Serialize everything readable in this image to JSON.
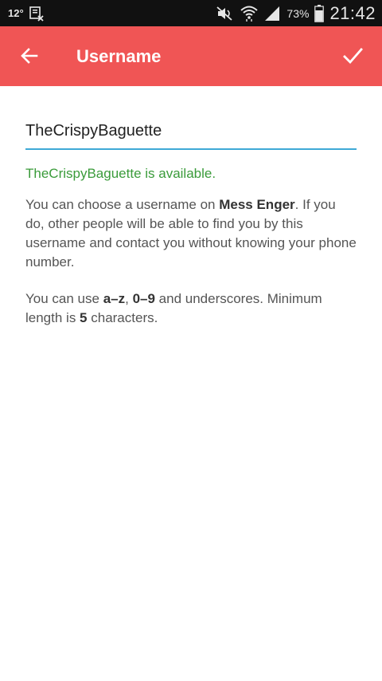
{
  "status_bar": {
    "temperature": "12°",
    "battery_percent": "73%",
    "time": "21:42"
  },
  "app_bar": {
    "title": "Username",
    "background": "#f05555"
  },
  "username": {
    "value": "TheCrispyBaguette"
  },
  "availability": {
    "text": "TheCrispyBaguette is available.",
    "color": "#3a9b3a"
  },
  "help_1": {
    "p1": "You can choose a username on ",
    "app_name": "Mess Enger",
    "p2": ". If you do, other people will be able to find you by this username and contact you without knowing your phone number."
  },
  "help_2": {
    "p1": "You can use ",
    "chars_az": "a–z",
    "sep": ", ",
    "chars_09": "0–9",
    "p2": " and underscores. Minimum length is ",
    "min_length": "5",
    "p3": " characters."
  }
}
